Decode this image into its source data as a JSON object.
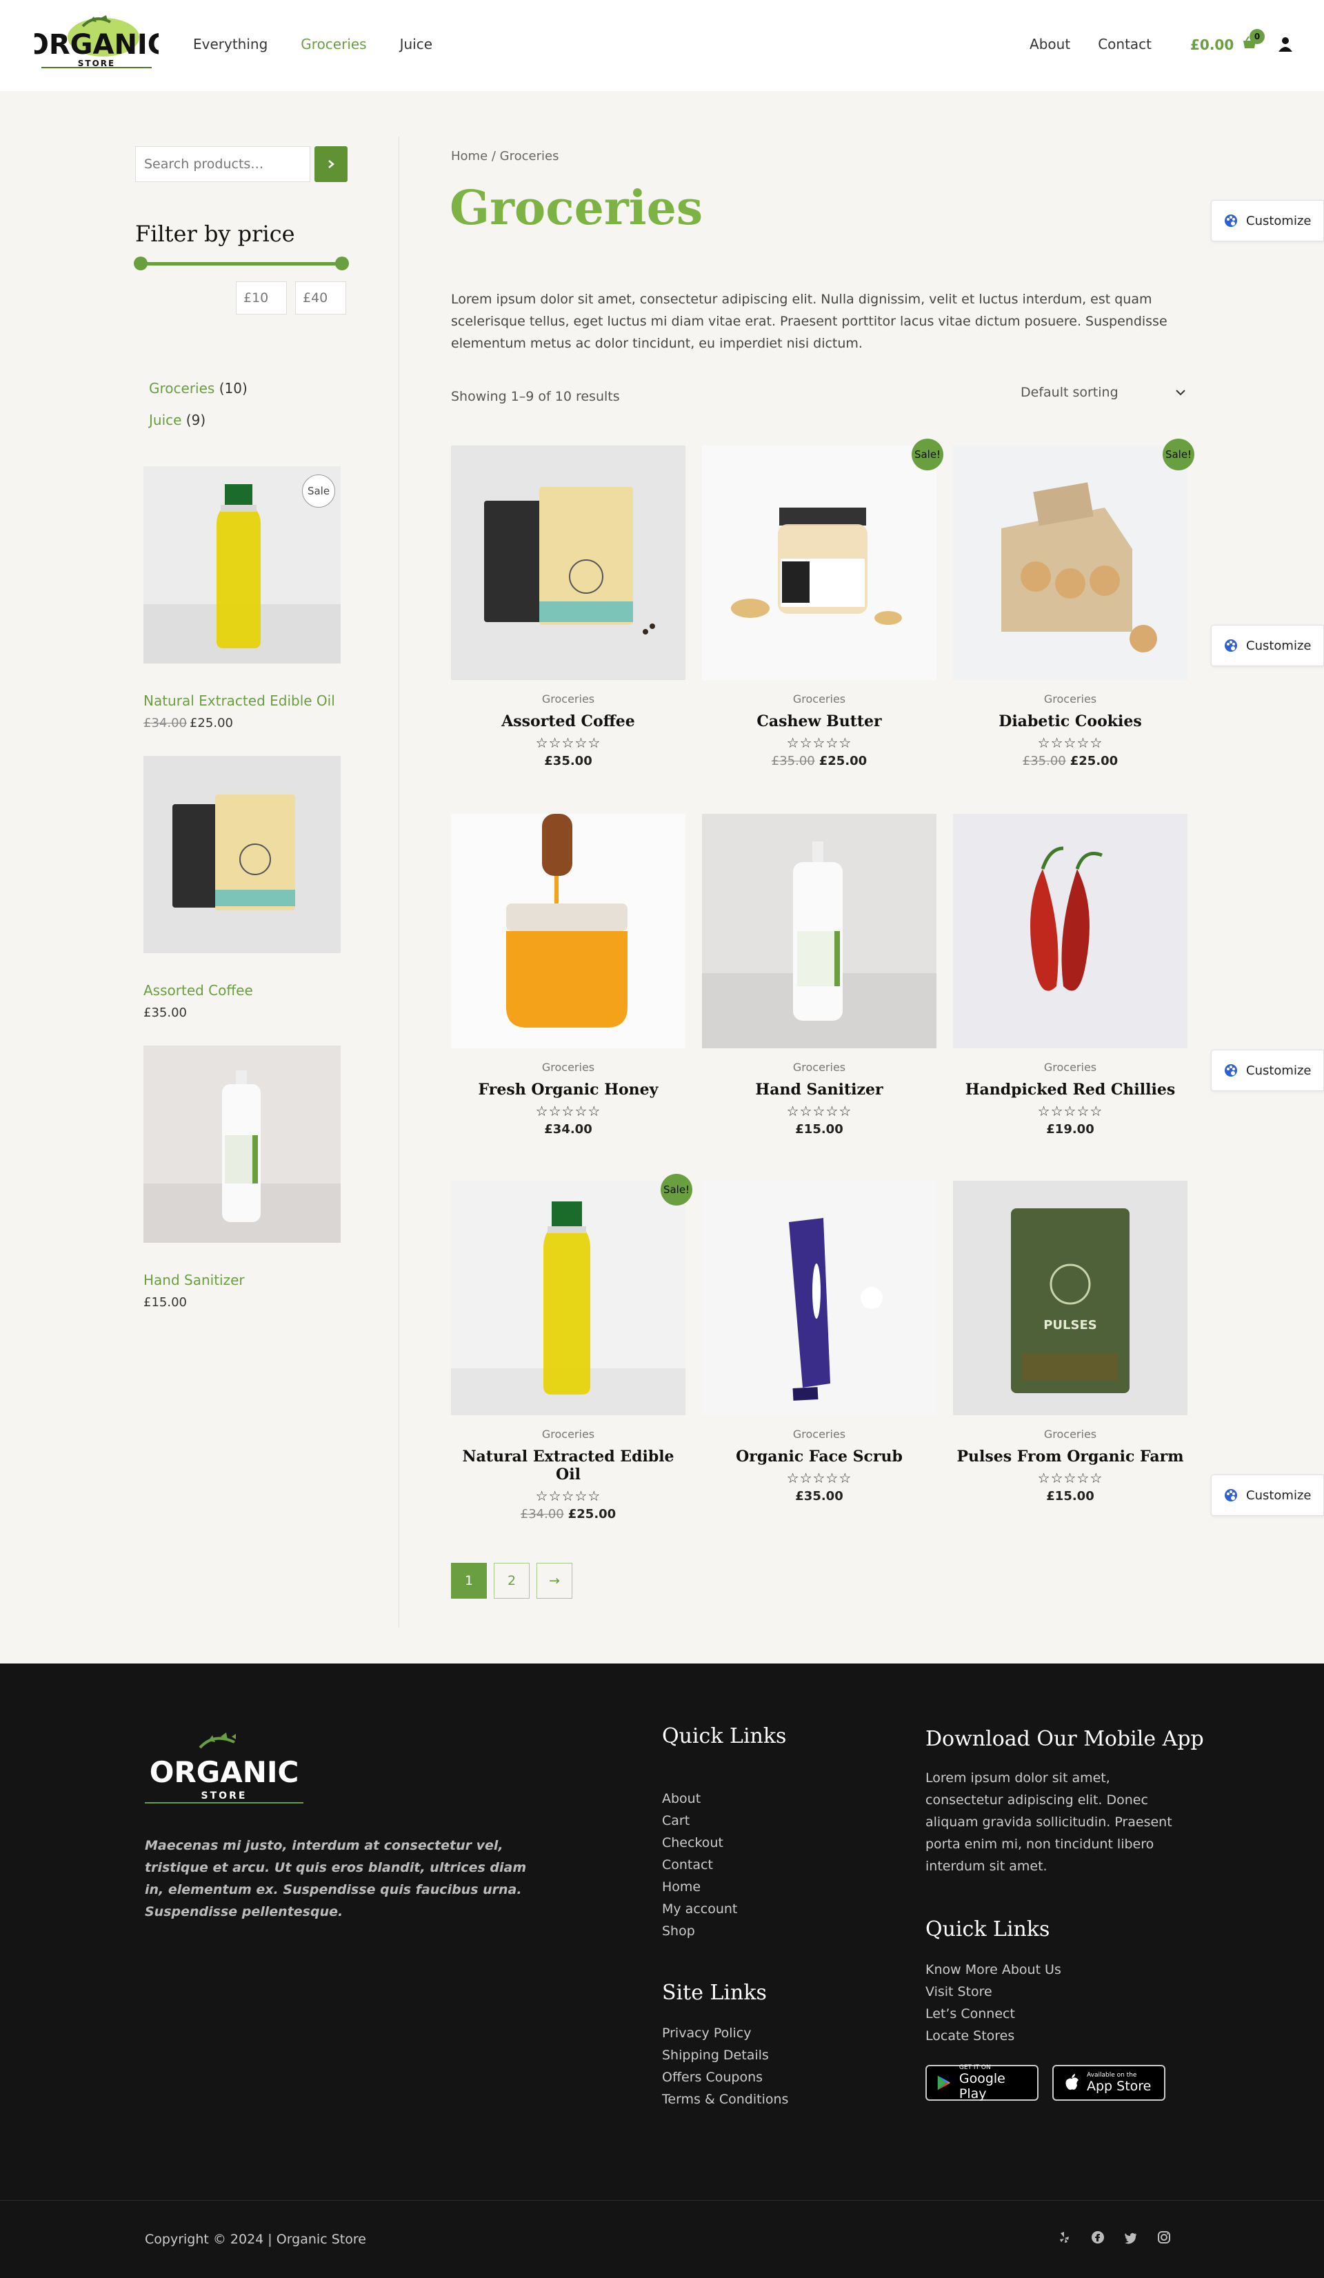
{
  "header": {
    "logo_text": "ORGANIC",
    "logo_sub": "STORE",
    "nav_left": [
      "Everything",
      "Groceries",
      "Juice"
    ],
    "nav_right": [
      "About",
      "Contact"
    ],
    "cart_total": "£0.00",
    "cart_count": "0"
  },
  "sidebar": {
    "search_placeholder": "Search products…",
    "filter_title": "Filter by price",
    "price_min": "£10",
    "price_max": "£40",
    "categories": [
      {
        "name": "Groceries",
        "count": "(10)"
      },
      {
        "name": "Juice",
        "count": "(9)"
      }
    ],
    "products": [
      {
        "title": "Natural Extracted Edible Oil",
        "old_price": "£34.00",
        "price": "£25.00",
        "badge": "Sale"
      },
      {
        "title": "Assorted Coffee",
        "price": "£35.00"
      },
      {
        "title": "Hand Sanitizer",
        "price": "£15.00"
      }
    ]
  },
  "main": {
    "breadcrumb": "Home / Groceries",
    "title": "Groceries",
    "description": "Lorem ipsum dolor sit amet, consectetur adipiscing elit. Nulla dignissim, velit et luctus interdum, est quam scelerisque tellus, eget luctus mi diam vitae erat. Praesent porttitor lacus vitae dictum posuere. Suspendisse elementum metus ac dolor tincidunt, eu imperdiet nisi dictum.",
    "results": "Showing 1–9 of 10 results",
    "sorting": "Default sorting",
    "stars": "☆☆☆☆☆",
    "sale_label": "Sale!",
    "products": [
      {
        "category": "Groceries",
        "name": "Assorted Coffee",
        "price": "£35.00"
      },
      {
        "category": "Groceries",
        "name": "Cashew Butter",
        "old_price": "£35.00",
        "price": "£25.00",
        "sale": true
      },
      {
        "category": "Groceries",
        "name": "Diabetic Cookies",
        "old_price": "£35.00",
        "price": "£25.00",
        "sale": true
      },
      {
        "category": "Groceries",
        "name": "Fresh Organic Honey",
        "price": "£34.00"
      },
      {
        "category": "Groceries",
        "name": "Hand Sanitizer",
        "price": "£15.00"
      },
      {
        "category": "Groceries",
        "name": "Handpicked Red Chillies",
        "price": "£19.00"
      },
      {
        "category": "Groceries",
        "name": "Natural Extracted Edible Oil",
        "old_price": "£34.00",
        "price": "£25.00",
        "sale": true
      },
      {
        "category": "Groceries",
        "name": "Organic Face Scrub",
        "price": "£35.00"
      },
      {
        "category": "Groceries",
        "name": "Pulses From Organic Farm",
        "price": "£15.00"
      }
    ],
    "pagination": [
      "1",
      "2",
      "→"
    ]
  },
  "customize_label": "Customize",
  "footer": {
    "tagline": "Maecenas mi justo, interdum at consectetur vel, tristique et arcu. Ut quis eros blandit, ultrices diam in, elementum ex. Suspendisse quis faucibus urna. Suspendisse pellentesque.",
    "quick_links_title": "Quick Links",
    "quick_links": [
      "About",
      "Cart",
      "Checkout",
      "Contact",
      "Home",
      "My account",
      "Shop"
    ],
    "site_links_title": "Site Links",
    "site_links": [
      "Privacy Policy",
      "Shipping Details",
      "Offers Coupons",
      "Terms & Conditions"
    ],
    "app_title": "Download Our Mobile App",
    "app_text": "Lorem ipsum dolor sit amet, consectetur adipiscing elit. Donec aliquam gravida sollicitudin. Praesent porta enim mi, non tincidunt libero interdum sit amet.",
    "quick_links2_title": "Quick Links",
    "quick_links2": [
      "Know More About Us",
      "Visit Store",
      "Let’s Connect",
      "Locate Stores"
    ],
    "google_play_small": "GET IT ON",
    "google_play_big": "Google Play",
    "app_store_small": "Available on the",
    "app_store_big": "App Store",
    "copyright": "Copyright © 2024 | Organic Store"
  },
  "colors": {
    "accent": "#6a9f3f",
    "title_green": "#7cb342",
    "footer_bg": "#141414"
  }
}
